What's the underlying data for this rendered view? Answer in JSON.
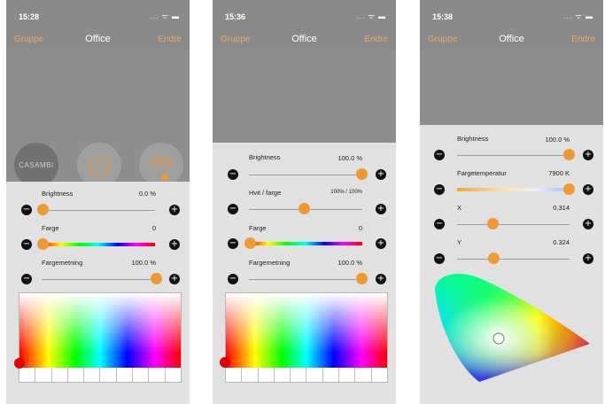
{
  "colors": {
    "accent": "#ee9a32",
    "nav_link": "#e9a55e"
  },
  "screens": [
    {
      "time": "15:28",
      "nav": {
        "left": "Gruppe",
        "title": "Office",
        "right": "Endre"
      },
      "logo": "CASAMBI",
      "icons": [
        "power-icon",
        "broadcast-icon"
      ],
      "sliders": {
        "brightness": {
          "label": "Brightness",
          "value": "0.0 %",
          "level": 0.0
        },
        "farge": {
          "label": "Farge",
          "value": "0",
          "level": 0.0
        },
        "fargemetning": {
          "label": "Fargemetning",
          "value": "100.0 %",
          "level": 1.0
        }
      }
    },
    {
      "time": "15:36",
      "nav": {
        "left": "Gruppe",
        "title": "Office",
        "right": "Endre"
      },
      "sliders": {
        "brightness": {
          "label": "Brightness",
          "value": "100.0 %",
          "level": 1.0
        },
        "hvit": {
          "label": "Hvit / farge",
          "value": "100% / 100%",
          "level": 0.5
        },
        "farge": {
          "label": "Farge",
          "value": "0",
          "level": 0.0
        },
        "fargemetning": {
          "label": "Fargemetning",
          "value": "100.0 %",
          "level": 1.0
        }
      }
    },
    {
      "time": "15:38",
      "nav": {
        "left": "Gruppe",
        "title": "Office",
        "right": "Endre"
      },
      "sliders": {
        "brightness": {
          "label": "Brightness",
          "value": "100.0 %",
          "level": 1.0
        },
        "temp": {
          "label": "Fargetemperatur",
          "value": "7900 K",
          "level": 1.0
        },
        "x": {
          "label": "X",
          "value": "0.314",
          "level": 0.314
        },
        "y": {
          "label": "Y",
          "value": "0.324",
          "level": 0.324
        }
      }
    }
  ],
  "buttons": {
    "minus": "−",
    "plus": "+"
  },
  "status_symbols": "... ᯤ ▬"
}
